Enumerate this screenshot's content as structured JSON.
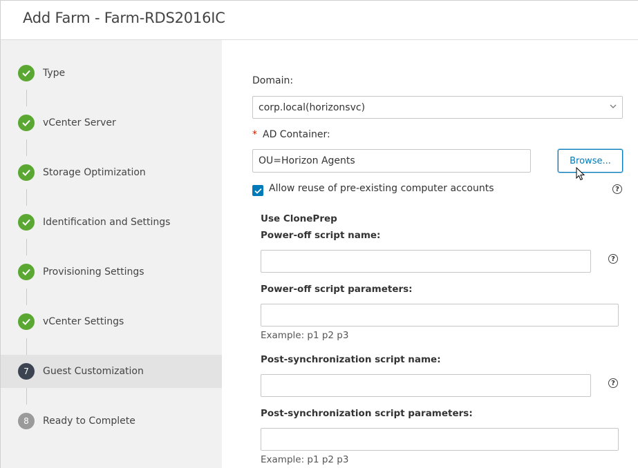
{
  "header": {
    "title": "Add Farm - Farm-RDS2016IC"
  },
  "sidebar": {
    "steps": [
      {
        "label": "Type",
        "state": "done"
      },
      {
        "label": "vCenter Server",
        "state": "done"
      },
      {
        "label": "Storage Optimization",
        "state": "done"
      },
      {
        "label": "Identification and Settings",
        "state": "done"
      },
      {
        "label": "Provisioning Settings",
        "state": "done"
      },
      {
        "label": "vCenter Settings",
        "state": "done"
      },
      {
        "label": "Guest Customization",
        "number": "7",
        "state": "current"
      },
      {
        "label": "Ready to Complete",
        "number": "8",
        "state": "todo"
      }
    ]
  },
  "form": {
    "domain_label": "Domain:",
    "domain_value": "corp.local(horizonsvc)",
    "ad_container_required_mark": "*",
    "ad_container_label": "AD Container:",
    "ad_container_value": "OU=Horizon Agents",
    "browse_label": "Browse...",
    "allow_reuse_label": "Allow reuse of pre-existing computer accounts",
    "allow_reuse_checked": true,
    "cloneprep_heading": "Use ClonePrep",
    "poweroff_name_label": "Power-off script name:",
    "poweroff_name_value": "",
    "poweroff_params_label": "Power-off script parameters:",
    "poweroff_params_value": "",
    "poweroff_params_hint": "Example: p1 p2 p3",
    "postsync_name_label": "Post-synchronization script name:",
    "postsync_name_value": "",
    "postsync_params_label": "Post-synchronization script parameters:",
    "postsync_params_value": "",
    "postsync_params_hint": "Example: p1 p2 p3",
    "help_glyph": "?"
  },
  "colors": {
    "done": "#5aa832",
    "current": "#3b4450",
    "todo": "#9a9a9a",
    "accent": "#0079b8",
    "required": "#c92100"
  },
  "icons": {
    "done_step": "checkmark-icon",
    "dropdown": "chevron-down-icon",
    "help": "help-circle-icon",
    "cursor": "mouse-pointer-icon"
  }
}
